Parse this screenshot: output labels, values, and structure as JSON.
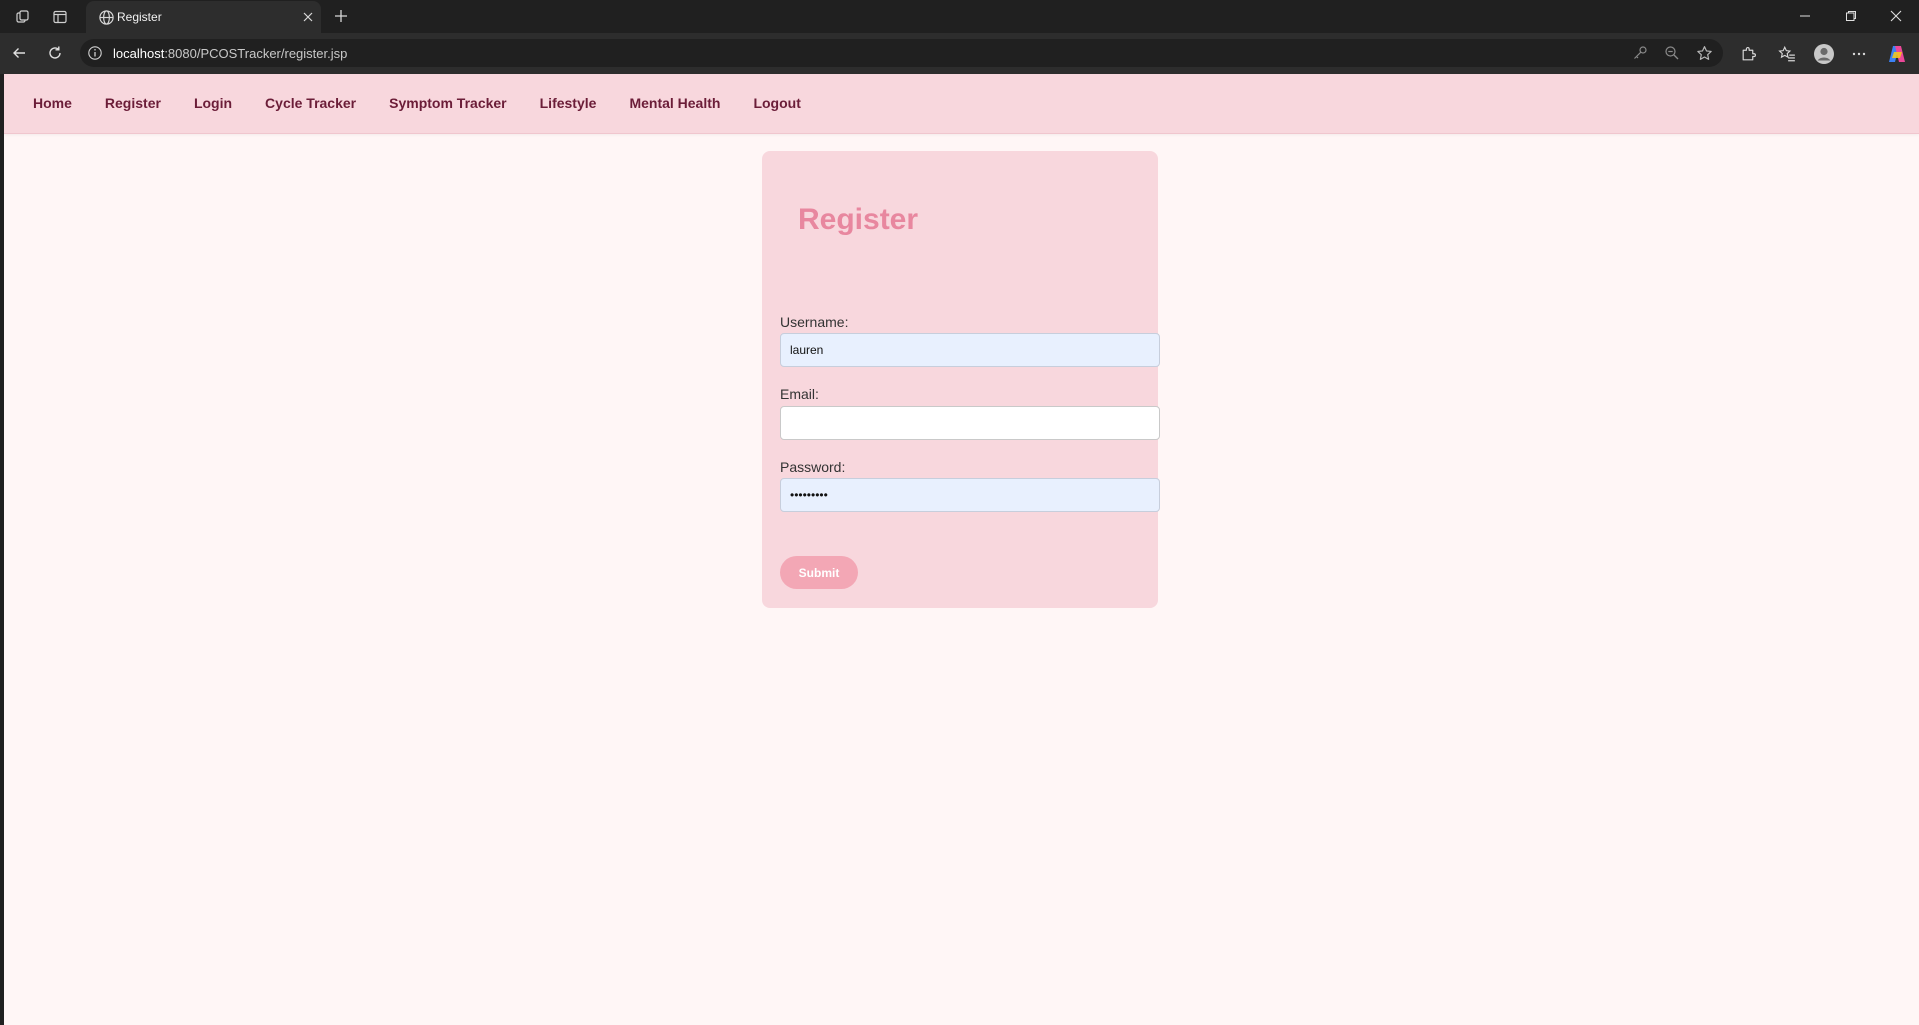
{
  "browser": {
    "tab_title": "Register",
    "url_host": "localhost",
    "url_rest": ":8080/PCOSTracker/register.jsp",
    "icons": [
      "workspaces-icon",
      "tab-actions-icon",
      "globe-icon",
      "close-icon",
      "new-tab-icon",
      "minimize-icon",
      "restore-icon",
      "window-close-icon",
      "back-icon",
      "refresh-icon",
      "info-icon",
      "key-icon",
      "zoom-out-icon",
      "favorite-star-icon",
      "extensions-icon",
      "favorites-icon",
      "profile-icon",
      "more-icon",
      "copilot-icon"
    ]
  },
  "nav": {
    "items": [
      "Home",
      "Register",
      "Login",
      "Cycle Tracker",
      "Symptom Tracker",
      "Lifestyle",
      "Mental Health",
      "Logout"
    ]
  },
  "form": {
    "title": "Register",
    "username_label": "Username:",
    "username_value": "lauren",
    "email_label": "Email:",
    "email_value": "",
    "password_label": "Password:",
    "password_mask": "•••••••••",
    "submit_label": "Submit"
  },
  "colors": {
    "nav_bg": "#f8d7dd",
    "nav_text": "#6b1d38",
    "page_bg": "#fff6f6",
    "card_bg": "#f8d7dd",
    "title": "#e8879f",
    "button": "#f3a7b5",
    "autofill": "#e8f0fe"
  }
}
